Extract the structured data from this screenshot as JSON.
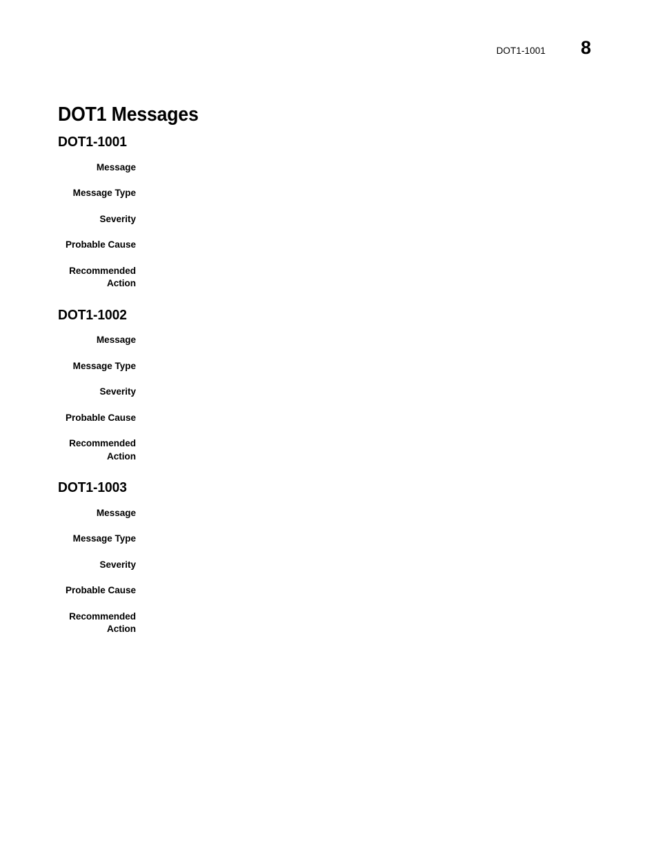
{
  "header": {
    "doc_id": "DOT1-1001",
    "page_number": "8"
  },
  "chapter": {
    "title": "DOT1 Messages"
  },
  "field_labels": {
    "message": "Message",
    "message_type": "Message Type",
    "severity": "Severity",
    "probable_cause": "Probable Cause",
    "recommended_action": "Recommended\nAction"
  },
  "sections": [
    {
      "heading": "DOT1-1001",
      "fields": [
        {
          "label": "Message",
          "value": ""
        },
        {
          "label": "Message Type",
          "value": ""
        },
        {
          "label": "Severity",
          "value": ""
        },
        {
          "label": "Probable Cause",
          "value": ""
        },
        {
          "label": "Recommended\nAction",
          "value": ""
        }
      ]
    },
    {
      "heading": "DOT1-1002",
      "fields": [
        {
          "label": "Message",
          "value": ""
        },
        {
          "label": "Message Type",
          "value": ""
        },
        {
          "label": "Severity",
          "value": ""
        },
        {
          "label": "Probable Cause",
          "value": ""
        },
        {
          "label": "Recommended\nAction",
          "value": ""
        }
      ]
    },
    {
      "heading": "DOT1-1003",
      "fields": [
        {
          "label": "Message",
          "value": ""
        },
        {
          "label": "Message Type",
          "value": ""
        },
        {
          "label": "Severity",
          "value": ""
        },
        {
          "label": "Probable Cause",
          "value": ""
        },
        {
          "label": "Recommended\nAction",
          "value": ""
        }
      ]
    }
  ]
}
